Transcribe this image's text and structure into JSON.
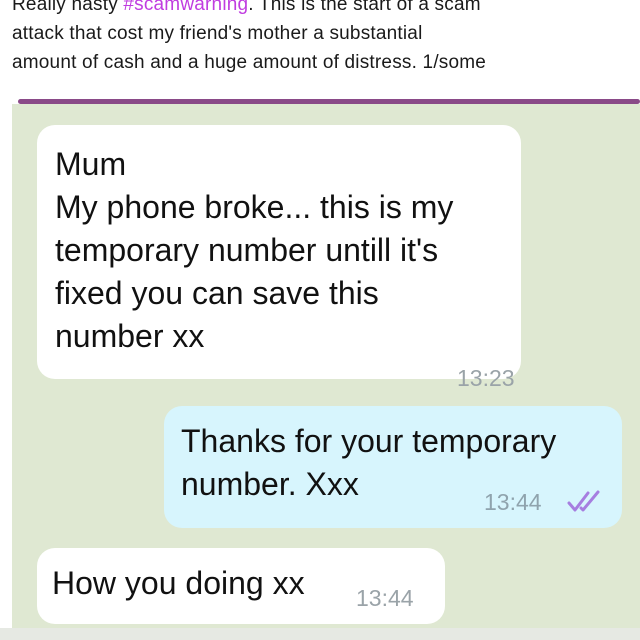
{
  "tweet": {
    "line1_prefix": "Really nasty ",
    "hashtag": "#scamwarning",
    "line1_suffix": ". This is the start of a scam",
    "line2": "attack that cost my friend's mother a substantial",
    "line3": "amount of cash and a huge amount of distress. 1/some"
  },
  "colors": {
    "hashtag": "#c03de0",
    "divider": "#8a4a88",
    "chat_background": "#dfe8d2",
    "incoming_bubble": "#ffffff",
    "outgoing_bubble": "#d7f5fd",
    "read_ticks": "#a67ee0"
  },
  "messages": [
    {
      "direction": "incoming",
      "lines": [
        "Mum",
        "My phone broke... this is my",
        "temporary number untill it's",
        "fixed you can save this",
        "number xx"
      ],
      "time": "13:23"
    },
    {
      "direction": "outgoing",
      "lines": [
        "Thanks for your temporary",
        "number. Xxx"
      ],
      "time": "13:44",
      "status_icon": "double-check-read-icon"
    },
    {
      "direction": "incoming",
      "lines": [
        "How you doing xx"
      ],
      "time": "13:44"
    }
  ]
}
